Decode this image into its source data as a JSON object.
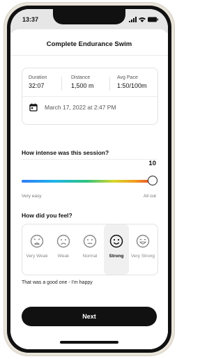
{
  "status": {
    "time": "13:37",
    "signal_icon": "signal-icon",
    "wifi_icon": "wifi-icon",
    "battery_icon": "battery-icon"
  },
  "header": {
    "title": "Complete Endurance Swim"
  },
  "stats": [
    {
      "label": "Duration",
      "value": "32:07"
    },
    {
      "label": "Distance",
      "value": "1,500 m"
    },
    {
      "label": "Avg Pace",
      "value": "1:50/100m"
    }
  ],
  "session": {
    "date": "March 17, 2022 at 2:47 PM",
    "calendar_icon": "calendar-icon"
  },
  "intensity": {
    "question": "How intense was this session?",
    "value": "10",
    "min_label": "Very easy",
    "max_label": "All out",
    "level_fraction": 1.0
  },
  "feeling": {
    "question": "How did you feel?",
    "options": [
      {
        "label": "Very Weak",
        "icon": "very-weak-face-icon"
      },
      {
        "label": "Weak",
        "icon": "weak-face-icon"
      },
      {
        "label": "Normal",
        "icon": "normal-face-icon"
      },
      {
        "label": "Strong",
        "icon": "strong-face-icon"
      },
      {
        "label": "Very Strong",
        "icon": "very-strong-face-icon"
      }
    ],
    "selected": "Strong",
    "note": "That was a good one - I'm happy"
  },
  "actions": {
    "next_label": "Next"
  },
  "colors": {
    "primary": "#111111",
    "gradient": [
      "#2e7cf6",
      "#2ec27e",
      "#d7d82b",
      "#f39a1f",
      "#e2332b"
    ]
  }
}
